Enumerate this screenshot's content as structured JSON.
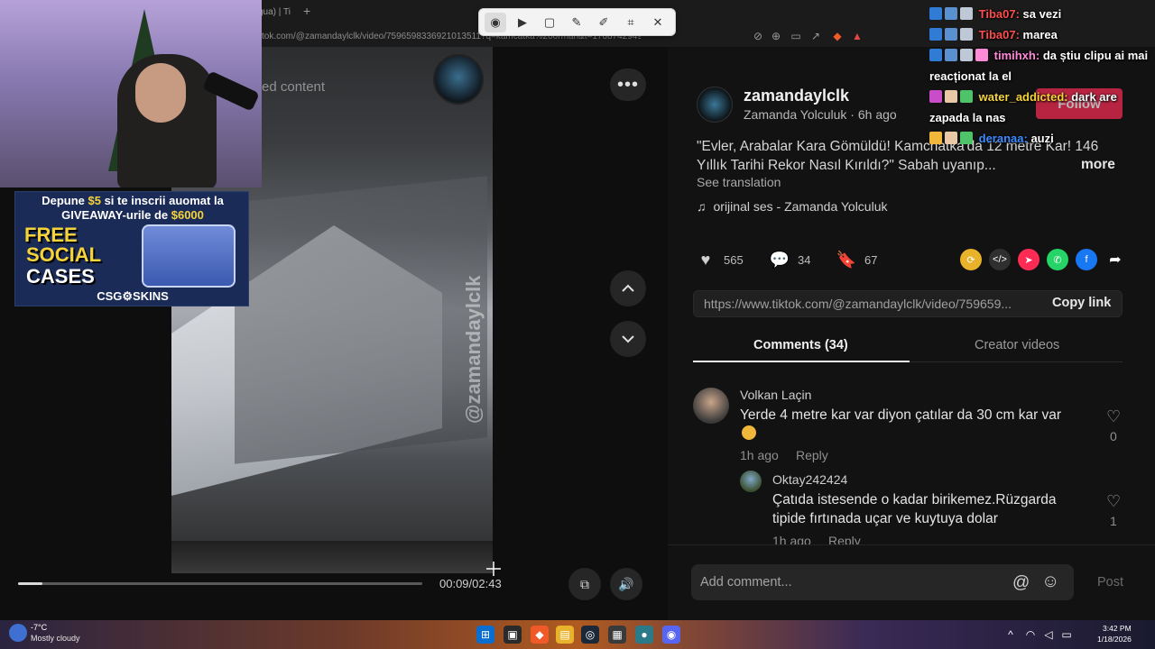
{
  "browser": {
    "tab_title": "gua) | Ti",
    "new_tab": "+",
    "url": "tok.com/@zamandaylclk/video/7596598336921013511?q=kamcatka%20orman&t=1768742949936"
  },
  "snip_tool": {
    "buttons": [
      "camera-icon",
      "video-icon",
      "rectangle-icon",
      "freeform-icon",
      "pen-icon",
      "text-extract-icon",
      "close-icon"
    ]
  },
  "video": {
    "sensitive_label": "ed content",
    "watermark": "@zamandaylclk",
    "progress": 0.06,
    "time": "00:09/02:43"
  },
  "webcam_ad": {
    "line1_pre": "Depune ",
    "line1_amount": "$5",
    "line1_post": " si te inscrii auomat la",
    "line2_pre": "GIVEAWAY-urile de ",
    "line2_amount": "$6000",
    "free": "FREE",
    "social": "SOCIAL",
    "cases": "CASES",
    "brand": "CSG⚙SKINS"
  },
  "post": {
    "username": "zamandaylclk",
    "display_name": "Zamanda Yolculuk",
    "age": "6h ago",
    "follow": "Follow",
    "description": "\"Evler, Arabalar Kara Gömüldü! Kamchatka'da 12 metre Kar! 146 Yıllık Tarihi Rekor Nasıl Kırıldı?\" Sabah uyanıp...",
    "more": "more",
    "see_translation": "See translation",
    "music": "orijinal ses - Zamanda Yolculuk",
    "likes": "565",
    "comments": "34",
    "saves": "67",
    "link": "https://www.tiktok.com/@zamandaylclk/video/759659...",
    "copy_link": "Copy link"
  },
  "share_colors": {
    "repost": "#e8b22a",
    "embed": "#2f2f2f",
    "send": "#fe2c55",
    "whatsapp": "#25d366",
    "facebook": "#1877f2"
  },
  "tabs": {
    "comments": "Comments (34)",
    "creator_videos": "Creator videos"
  },
  "comment_list": [
    {
      "author": "Volkan Laçin",
      "text": "Yerde 4 metre kar var diyon çatılar da 30 cm kar var",
      "time": "1h ago",
      "reply": "Reply",
      "likes": "0"
    },
    {
      "author": "Oktay242424",
      "text": "Çatıda istesende o kadar birikemez.Rüzgarda tipide fırtınada uçar ve kuytuya dolar",
      "time": "1h ago",
      "reply": "Reply",
      "likes": "1"
    }
  ],
  "comment_box": {
    "placeholder": "Add comment...",
    "post": "Post"
  },
  "chat": [
    {
      "user": "Tiba07:",
      "color": "#ff4d4d",
      "message": "sa vezi"
    },
    {
      "user": "Tiba07:",
      "color": "#ff4d4d",
      "message": "marea"
    },
    {
      "user": "timihxh:",
      "color": "#ff8ad8",
      "message": "da știu clipu ai mai reacționat la el"
    },
    {
      "user": "water_addicted:",
      "color": "#f5d33b",
      "message": "dark are zapada la nas"
    },
    {
      "user": "deranaa:",
      "color": "#3c8cff",
      "message": "auzi"
    }
  ],
  "taskbar": {
    "weather_temp": "-7°C",
    "weather_desc": "Mostly cloudy",
    "time": "3:42 PM",
    "date": "1/18/2026"
  }
}
